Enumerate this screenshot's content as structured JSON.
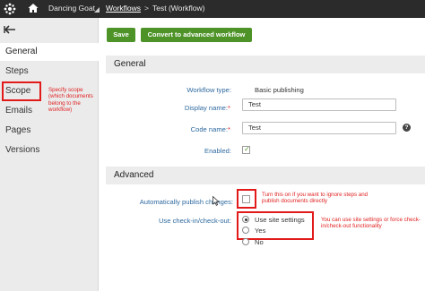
{
  "topbar": {
    "site_name": "Dancing Goat",
    "breadcrumb_link": "Workflows",
    "breadcrumb_sep": ">",
    "breadcrumb_current": "Test (Workflow)"
  },
  "sidebar": {
    "items": [
      {
        "label": "General"
      },
      {
        "label": "Steps"
      },
      {
        "label": "Scope"
      },
      {
        "label": "Emails"
      },
      {
        "label": "Pages"
      },
      {
        "label": "Versions"
      }
    ],
    "active": "General",
    "scope_note": "Specify scope (which documents belong to the workflow)"
  },
  "toolbar": {
    "save_label": "Save",
    "convert_label": "Convert to advanced workflow"
  },
  "general": {
    "title": "General",
    "workflow_type_label": "Workflow type:",
    "workflow_type_value": "Basic publishing",
    "display_name_label": "Display name:",
    "display_name_value": "Test",
    "code_name_label": "Code name:",
    "code_name_value": "Test",
    "enabled_label": "Enabled:",
    "enabled_checked": true,
    "required_marker": "*"
  },
  "advanced": {
    "title": "Advanced",
    "auto_publish_label": "Automatically publish changes:",
    "auto_publish_checked": false,
    "auto_publish_note": "Turn this on if you want to ignore steps and publish documents directly",
    "checkin_label": "Use check-in/check-out:",
    "checkin_options": [
      {
        "label": "Use site settings",
        "selected": true
      },
      {
        "label": "Yes",
        "selected": false
      },
      {
        "label": "No",
        "selected": false
      }
    ],
    "checkin_note": "You can use site settings or force check-in/check-out functionality"
  },
  "colors": {
    "accent_green": "#4d9327",
    "annotation_red": "#e21a1a",
    "topbar": "#2b2b2b",
    "label_blue": "#2f6aa0"
  },
  "icons": [
    "kentico-logo-icon",
    "home-icon",
    "chevron-down-icon",
    "back-arrow-icon",
    "help-icon",
    "cursor-icon"
  ]
}
